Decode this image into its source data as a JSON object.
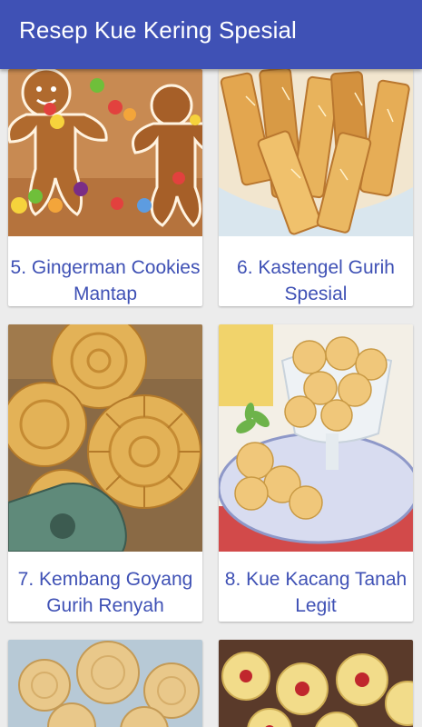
{
  "appbar": {
    "title": "Resep Kue Kering Spesial"
  },
  "recipes": [
    {
      "line1": "5. Gingerman Cookies",
      "line2": "Mantap"
    },
    {
      "line1": "6. Kastengel Gurih",
      "line2": "Spesial"
    },
    {
      "line1": "7. Kembang Goyang",
      "line2": "Gurih Renyah"
    },
    {
      "line1": "8. Kue Kacang Tanah",
      "line2": "Legit"
    }
  ],
  "colors": {
    "primary": "#3f51b5",
    "caption": "#3f51b5",
    "background": "#ececec"
  }
}
